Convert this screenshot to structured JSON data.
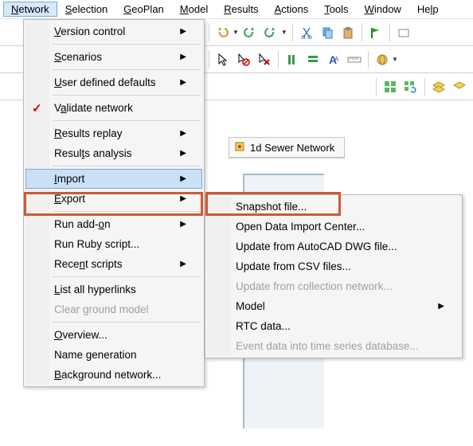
{
  "menubar": {
    "network": "Network",
    "selection": "Selection",
    "geoplan": "GeoPlan",
    "model": "Model",
    "results": "Results",
    "actions": "Actions",
    "tools": "Tools",
    "window": "Window",
    "help": "Help"
  },
  "network_menu": {
    "version_control": "Version control",
    "scenarios": "Scenarios",
    "user_defined_defaults": "User defined defaults",
    "validate_network": "Validate network",
    "results_replay": "Results replay",
    "results_analysis": "Results analysis",
    "import": "Import",
    "export": "Export",
    "run_addon": "Run add-on",
    "run_ruby": "Run Ruby script...",
    "recent_scripts": "Recent scripts",
    "list_hyperlinks": "List all hyperlinks",
    "clear_ground": "Clear ground model",
    "overview": "Overview...",
    "name_generation": "Name generation",
    "background_network": "Background network..."
  },
  "import_submenu": {
    "snapshot": "Snapshot file...",
    "open_data": "Open Data Import Center...",
    "update_dwg": "Update from AutoCAD DWG file...",
    "update_csv": "Update from CSV files...",
    "update_collection": "Update from collection network...",
    "model": "Model",
    "rtc": "RTC data...",
    "event_data": "Event data into time series database..."
  },
  "tab": {
    "label": "1d Sewer Network"
  }
}
